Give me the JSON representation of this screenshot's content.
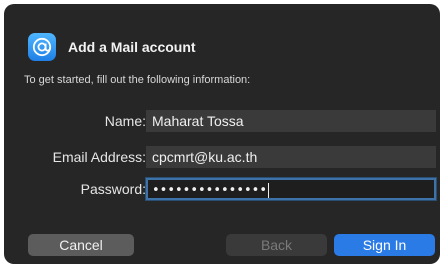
{
  "dialog": {
    "title": "Add a Mail account",
    "subtitle": "To get started, fill out the following information:",
    "icon": "mail-at-icon"
  },
  "form": {
    "name_label": "Name:",
    "name_value": "Maharat Tossa",
    "email_label": "Email Address:",
    "email_value": "cpcmrt@ku.ac.th",
    "password_label": "Password:",
    "password_masked": "•••••••••••••••"
  },
  "buttons": {
    "cancel": "Cancel",
    "back": "Back",
    "sign_in": "Sign In"
  },
  "colors": {
    "background": "#262626",
    "accent": "#2a7be6",
    "focus_ring": "#3d73a8"
  }
}
